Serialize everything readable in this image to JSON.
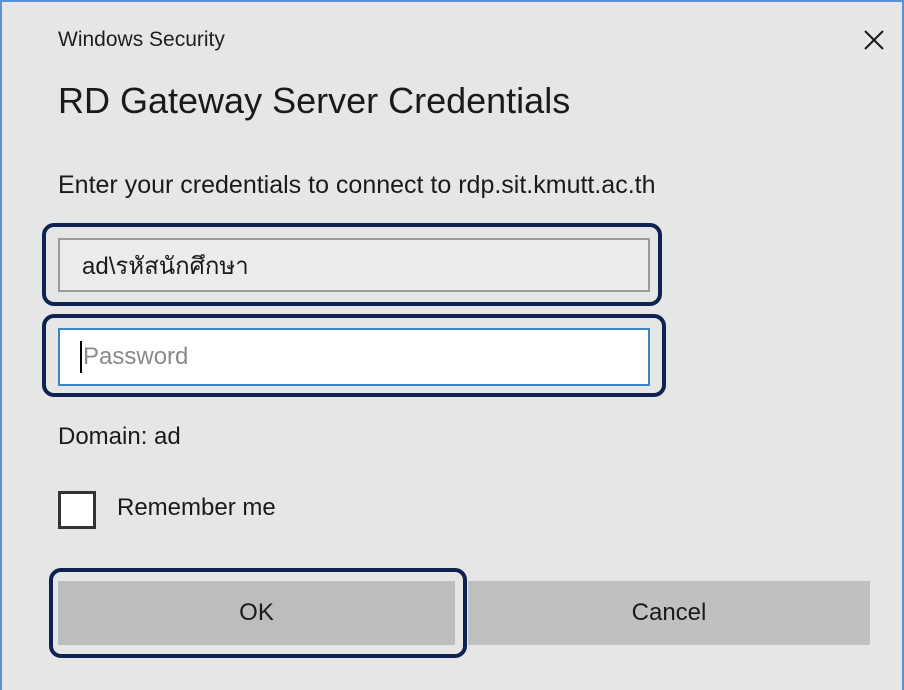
{
  "window": {
    "title": "Windows Security",
    "close_icon": "close-icon"
  },
  "dialog": {
    "heading": "RD Gateway Server Credentials",
    "description": "Enter your credentials to connect to rdp.sit.kmutt.ac.th"
  },
  "form": {
    "username_value": "ad\\รหัสนักศึกษา",
    "password_placeholder": "Password",
    "password_value": "",
    "domain_text": "Domain: ad",
    "remember_label": "Remember me",
    "remember_checked": false
  },
  "buttons": {
    "ok_label": "OK",
    "cancel_label": "Cancel"
  },
  "colors": {
    "dialog_bg": "#e6e6e6",
    "window_border": "#5c8fd6",
    "highlight_outline": "#0e2350",
    "focus_border": "#3d86c6",
    "button_bg": "#c0c0c0"
  }
}
